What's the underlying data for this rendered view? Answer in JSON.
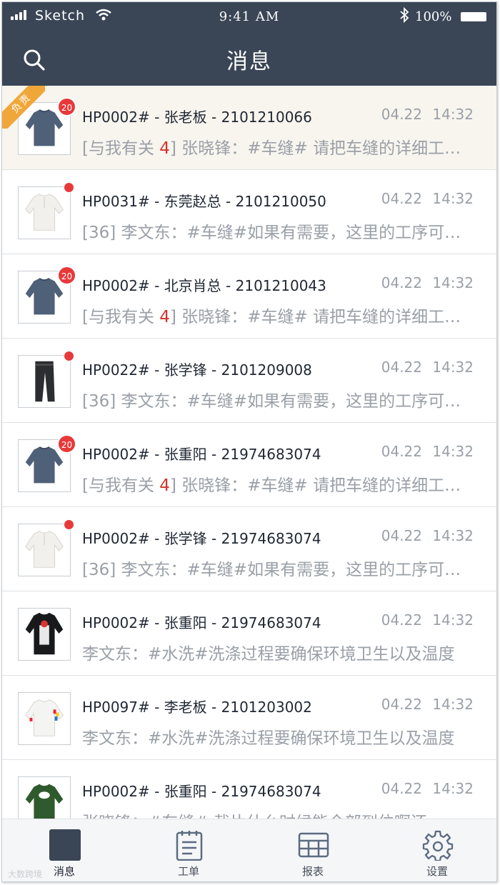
{
  "status_bar": {
    "carrier": "Sketch",
    "time": "9:41 AM",
    "battery": "100%"
  },
  "nav": {
    "title": "消息",
    "search_icon": "search-icon"
  },
  "messages": [
    {
      "title": "HP0002# - 张老板 - 2101210066",
      "time": "04.22  14:32",
      "badge": "20",
      "corner_label": "负责",
      "preview_prefix_open": "[与我有关 ",
      "preview_count": "4",
      "preview_prefix_close": "]",
      "preview_body": " 张晓锋：#车缝# 请把车缝的详细工序发给我"
    },
    {
      "title": "HP0031# - 东莞赵总 - 2101210050",
      "time": "04.22  14:32",
      "preview_prefix_open": "[36]",
      "preview_body": " 李文东：#车缝#如果有需要，这里的工序可以再调整"
    },
    {
      "title": "HP0002# - 北京肖总 - 2101210043",
      "time": "04.22  14:32",
      "badge": "20",
      "preview_prefix_open": "[与我有关 ",
      "preview_count": "4",
      "preview_prefix_close": "]",
      "preview_body": " 张晓锋：#车缝# 请把车缝的详细工序发给我"
    },
    {
      "title": "HP0022# - 张学锋 - 2101209008",
      "time": "04.22  14:32",
      "preview_prefix_open": "[36]",
      "preview_body": " 李文东：#车缝#如果有需要，这里的工序可以再调整"
    },
    {
      "title": "HP0002# - 张重阳 - 21974683074",
      "time": "04.22  14:32",
      "badge": "20",
      "preview_prefix_open": "[与我有关 ",
      "preview_count": "4",
      "preview_prefix_close": "]",
      "preview_body": " 张晓锋：#车缝# 请把车缝的详细工序发给我"
    },
    {
      "title": "HP0002# - 张学锋 - 21974683074",
      "time": "04.22  14:32",
      "preview_prefix_open": "[36]",
      "preview_body": " 李文东：#车缝#如果有需要，这里的工序可以再调整"
    },
    {
      "title": "HP0002# - 张重阳 - 21974683074",
      "time": "04.22  14:32",
      "preview_body": "李文东：#水洗#洗涤过程要确保环境卫生以及温度"
    },
    {
      "title": "HP0097# - 李老板 - 2101203002",
      "time": "04.22  14:32",
      "preview_body": "李文东：#水洗#洗涤过程要确保环境卫生以及温度"
    },
    {
      "title": "HP0002# - 张重阳 - 21974683074",
      "time": "04.22  14:32",
      "preview_body": "张晓锋：#车缝# 裁片什么时候能全部到位啊还"
    }
  ],
  "tabs": [
    {
      "label": "消息",
      "icon": "message-icon",
      "active": true
    },
    {
      "label": "工单",
      "icon": "clipboard-icon"
    },
    {
      "label": "报表",
      "icon": "table-icon"
    },
    {
      "label": "设置",
      "icon": "gear-icon"
    }
  ],
  "watermark": "大数跨境",
  "colors": {
    "header": "#3a4656",
    "badge": "#e8393a",
    "highlight_row": "#f8f5ee",
    "corner_ribbon": "#f0a73a"
  }
}
